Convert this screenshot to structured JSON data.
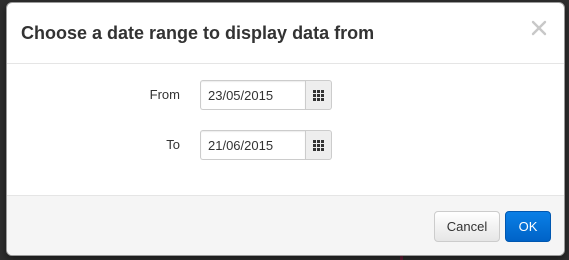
{
  "dialog": {
    "title": "Choose a date range to display data from",
    "close_icon": "close-icon"
  },
  "form": {
    "from": {
      "label": "From",
      "value": "23/05/2015",
      "button_icon": "calendar-grid-icon"
    },
    "to": {
      "label": "To",
      "value": "21/06/2015",
      "button_icon": "calendar-grid-icon"
    }
  },
  "footer": {
    "cancel_label": "Cancel",
    "ok_label": "OK"
  },
  "colors": {
    "primary": "#0a6fd6",
    "footer_bg": "#f5f5f5",
    "backdrop": "#2f2f2f"
  }
}
